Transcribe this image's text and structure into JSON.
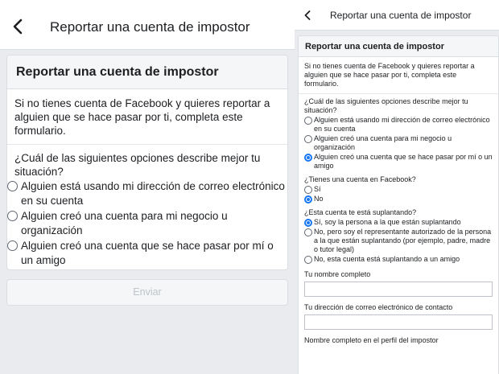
{
  "left": {
    "header_title": "Reportar una cuenta de impostor",
    "card_title": "Reportar una cuenta de impostor",
    "intro": "Si no tienes cuenta de Facebook y quieres reportar a alguien que se hace pasar por ti, completa este formulario.",
    "question": "¿Cuál de las siguientes opciones describe mejor tu situación?",
    "options": [
      "Alguien está usando mi dirección de correo electrónico en su cuenta",
      "Alguien creó una cuenta para mi negocio u organización",
      "Alguien creó una cuenta que se hace pasar por mí o un amigo"
    ],
    "submit_label": "Enviar"
  },
  "right": {
    "header_title": "Reportar una cuenta de impostor",
    "card_title": "Reportar una cuenta de impostor",
    "intro": "Si no tienes cuenta de Facebook y quieres reportar a alguien que se hace pasar por ti, completa este formulario.",
    "q1": "¿Cuál de las siguientes opciones describe mejor tu situación?",
    "q1_options": [
      "Alguien está usando mi dirección de correo electrónico en su cuenta",
      "Alguien creó una cuenta para mi negocio u organización",
      "Alguien creó una cuenta que se hace pasar por mí o un amigo"
    ],
    "q1_selected": 2,
    "q2": "¿Tienes una cuenta en Facebook?",
    "q2_options": [
      "Sí",
      "No"
    ],
    "q2_selected": 1,
    "q3": "¿Esta cuenta te está suplantando?",
    "q3_options": [
      "Sí, soy la persona a la que están suplantando",
      "No, pero soy el representante autorizado de la persona a la que están suplantando (por ejemplo, padre, madre o tutor legal)",
      "No, esta cuenta está suplantando a un amigo"
    ],
    "q3_selected": 0,
    "field_full_name": "Tu nombre completo",
    "field_email": "Tu dirección de correo electrónico de contacto",
    "field_profile_name": "Nombre completo en el perfil del impostor"
  },
  "colors": {
    "accent": "#1877f2",
    "background": "#e9ebee",
    "text": "#1c1e21",
    "disabled_text": "#bec3c9"
  },
  "icons": {
    "back": "chevron-left-icon",
    "radio": "radio-icon"
  }
}
